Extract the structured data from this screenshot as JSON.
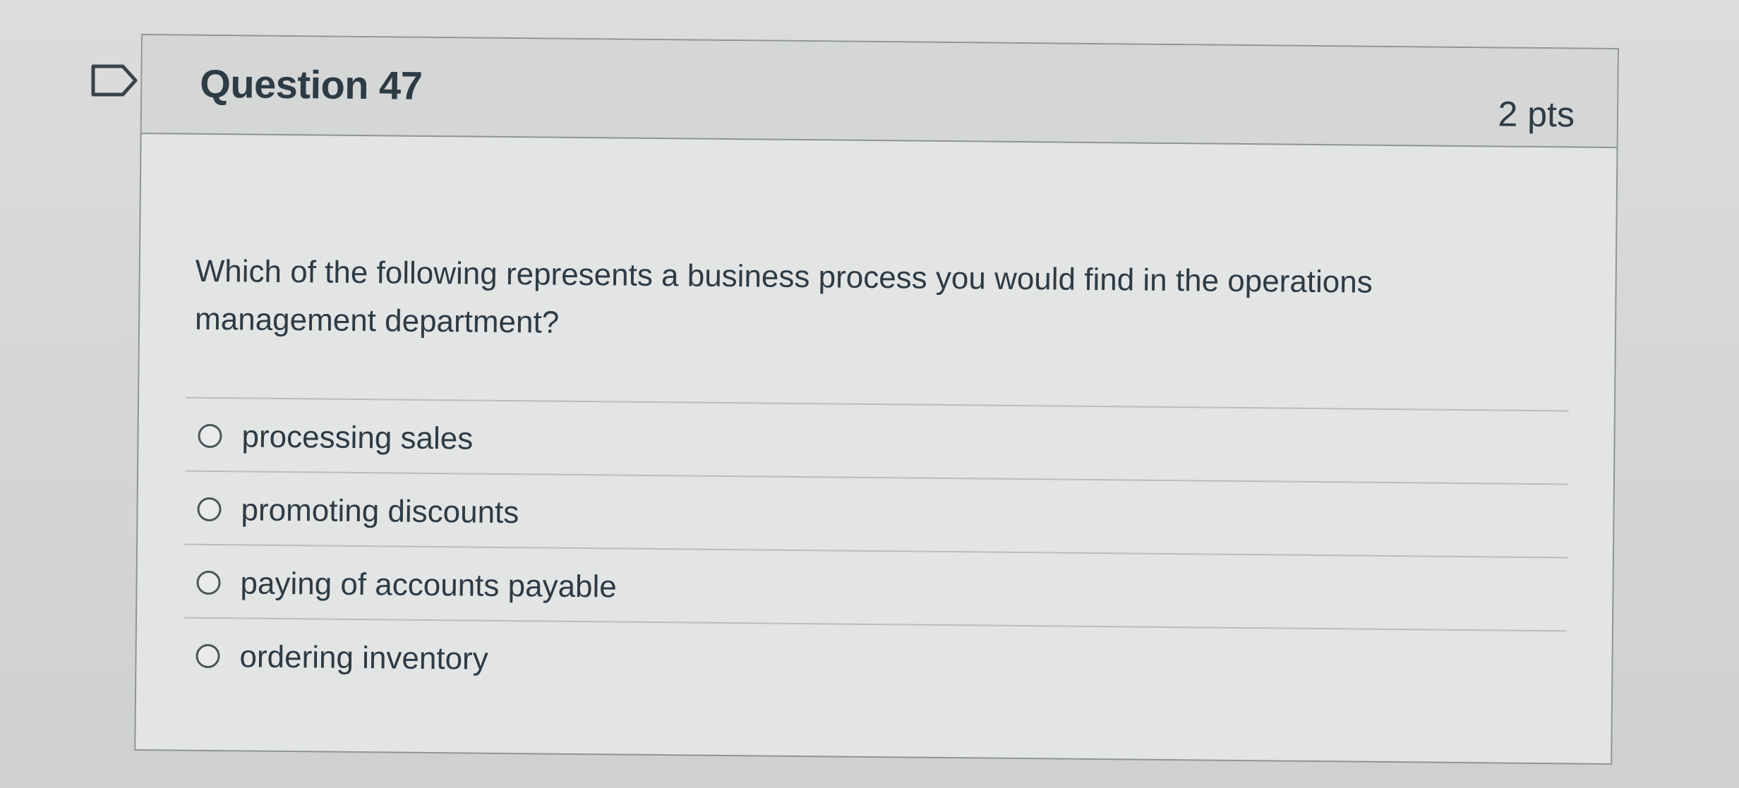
{
  "question": {
    "title": "Question 47",
    "points": "2 pts",
    "text": "Which of the following represents a business process you would find in the operations management department?",
    "flag_icon": "flag-outline-icon"
  },
  "answers": [
    {
      "label": "processing sales",
      "selected": false
    },
    {
      "label": "promoting discounts",
      "selected": false
    },
    {
      "label": "paying of accounts payable",
      "selected": false
    },
    {
      "label": "ordering inventory",
      "selected": false
    }
  ],
  "colors": {
    "text": "#2d3b45",
    "header_bg": "#d5d6d6",
    "card_bg": "#e3e4e4",
    "border": "#8e9497"
  }
}
